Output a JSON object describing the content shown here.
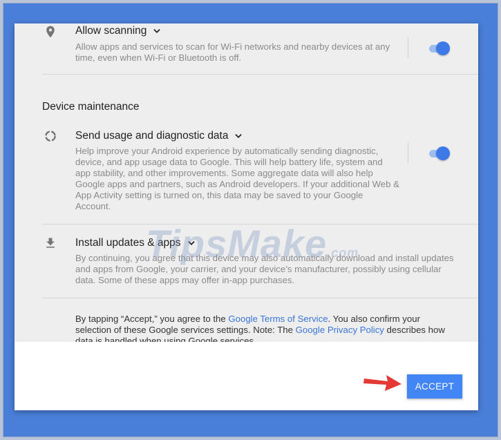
{
  "scanning": {
    "title": "Allow scanning",
    "description": "Allow apps and services to scan for Wi-Fi networks and nearby devices at any time, even when Wi-Fi or Bluetooth is off.",
    "icon": "location-pin-icon",
    "toggle_on": true
  },
  "maintenance_heading": "Device maintenance",
  "usage": {
    "title": "Send usage and diagnostic data",
    "description": "Help improve your Android experience by automatically sending diagnostic, device, and app usage data to Google. This will help battery life, system and app stability, and other improvements. Some aggregate data will also help Google apps and partners, such as Android developers. If your additional Web & App Activity setting is turned on, this data may be saved to your Google Account.",
    "icon": "diagnostics-ring-icon",
    "toggle_on": true
  },
  "updates": {
    "title": "Install updates & apps",
    "description": "By continuing, you agree that this device may also automatically download and install updates and apps from Google, your carrier, and your device’s manufacturer, possibly using cellular data. Some of these apps may offer in-app purchases.",
    "icon": "download-icon"
  },
  "legal": {
    "part1": "By tapping “Accept,” you agree to the ",
    "terms_link": "Google Terms of Service",
    "part2": ". You also confirm your selection of these Google services settings. Note: The ",
    "privacy_link": "Google Privacy Policy",
    "part3": " describes how data is handled when using Google services."
  },
  "accept_label": "ACCEPT",
  "watermark": {
    "text": "TipsMake",
    "suffix": ".com"
  },
  "colors": {
    "accent": "#4285f4",
    "link": "#3a75d6",
    "background": "#4a7fd9",
    "arrow": "#e53935"
  }
}
